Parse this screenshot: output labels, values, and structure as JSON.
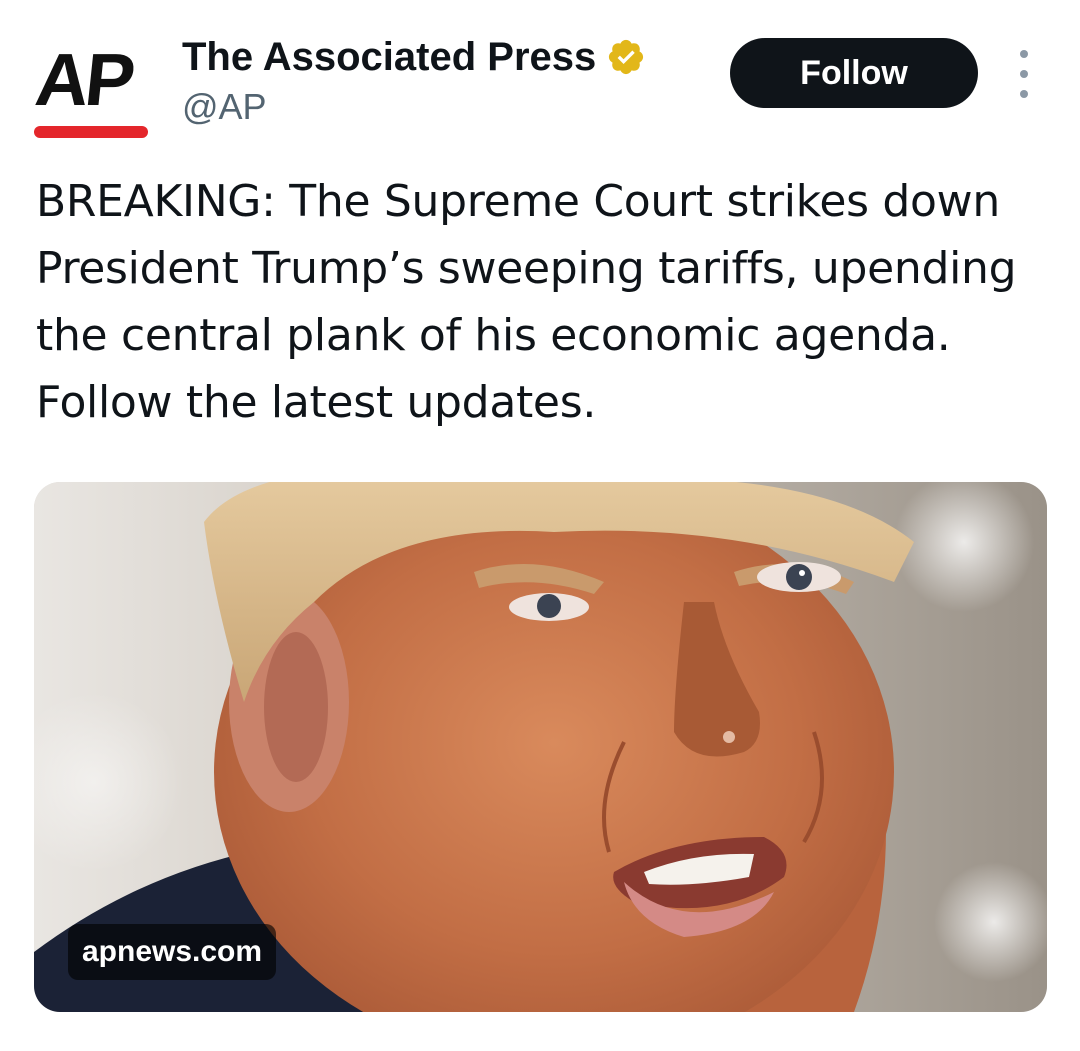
{
  "account": {
    "avatar_text": "AP",
    "display_name": "The Associated Press",
    "handle": "@AP",
    "verified": true,
    "verified_icon": "verified-badge-icon",
    "brand_color": "#e4262b",
    "badge_color": "#e2b719"
  },
  "actions": {
    "follow_label": "Follow",
    "more_icon": "more-vertical-icon"
  },
  "tweet": {
    "text": "BREAKING: The Supreme Court strikes down President Trump’s sweeping tariffs, upending the central plank of his economic agenda. Follow the latest updates."
  },
  "media": {
    "source_domain": "apnews.com"
  }
}
